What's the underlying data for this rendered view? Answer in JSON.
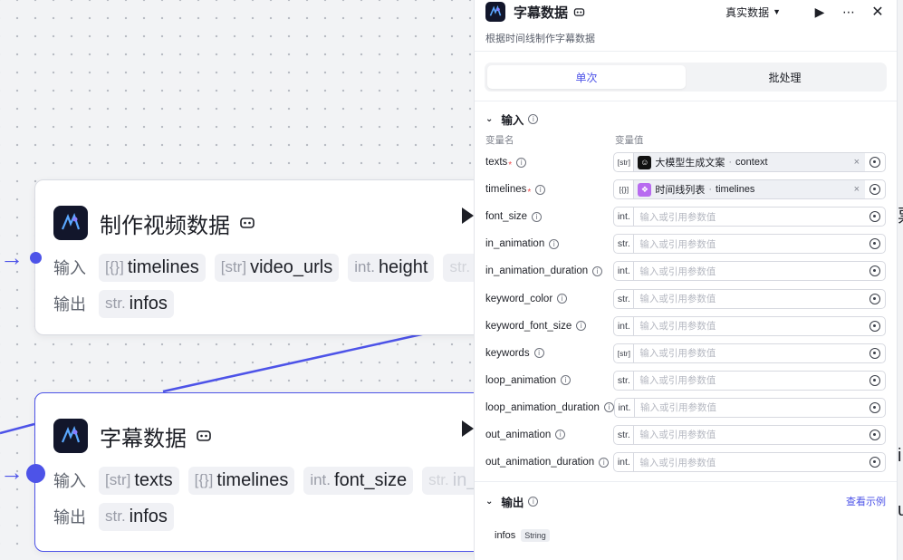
{
  "canvas": {
    "nodes": [
      {
        "title": "制作视频数据",
        "input_label": "输入",
        "output_label": "输出",
        "inputs": [
          {
            "type": "[{}]",
            "name": "timelines"
          },
          {
            "type": "[str]",
            "name": "video_urls"
          },
          {
            "type": "int.",
            "name": "height"
          },
          {
            "type": "str.",
            "name": ""
          }
        ],
        "outputs": [
          {
            "type": "str.",
            "name": "infos"
          }
        ]
      },
      {
        "title": "字幕数据",
        "input_label": "输入",
        "output_label": "输出",
        "inputs": [
          {
            "type": "[str]",
            "name": "texts"
          },
          {
            "type": "[{}]",
            "name": "timelines"
          },
          {
            "type": "int.",
            "name": "font_size"
          },
          {
            "type": "str.",
            "name": "in_"
          }
        ],
        "outputs": [
          {
            "type": "str.",
            "name": "infos"
          }
        ]
      }
    ],
    "colors": {
      "accent": "#4d53e8",
      "canvas_bg": "#f2f3f5"
    }
  },
  "panel": {
    "title": "字幕数据",
    "mode": "真实数据",
    "description": "根据时间线制作字幕数据",
    "tabs": [
      {
        "label": "单次",
        "active": true
      },
      {
        "label": "批处理",
        "active": false
      }
    ],
    "input_section": "输入",
    "col_name": "变量名",
    "col_value": "变量值",
    "params": [
      {
        "name": "texts",
        "required": true,
        "type": "[str]",
        "ref": {
          "source": "大模型生成文案",
          "field": "context",
          "icon_color": "#111111"
        }
      },
      {
        "name": "timelines",
        "required": true,
        "type": "[{}]",
        "ref": {
          "source": "时间线列表",
          "field": "timelines",
          "icon_color": "#b86bf0"
        }
      },
      {
        "name": "font_size",
        "required": false,
        "type": "int.",
        "placeholder": "输入或引用参数值"
      },
      {
        "name": "in_animation",
        "required": false,
        "type": "str.",
        "placeholder": "输入或引用参数值"
      },
      {
        "name": "in_animation_duration",
        "required": false,
        "type": "int.",
        "placeholder": "输入或引用参数值"
      },
      {
        "name": "keyword_color",
        "required": false,
        "type": "str.",
        "placeholder": "输入或引用参数值"
      },
      {
        "name": "keyword_font_size",
        "required": false,
        "type": "int.",
        "placeholder": "输入或引用参数值"
      },
      {
        "name": "keywords",
        "required": false,
        "type": "[str]",
        "placeholder": "输入或引用参数值"
      },
      {
        "name": "loop_animation",
        "required": false,
        "type": "str.",
        "placeholder": "输入或引用参数值"
      },
      {
        "name": "loop_animation_duration",
        "required": false,
        "type": "int.",
        "placeholder": "输入或引用参数值"
      },
      {
        "name": "out_animation",
        "required": false,
        "type": "str.",
        "placeholder": "输入或引用参数值"
      },
      {
        "name": "out_animation_duration",
        "required": false,
        "type": "int.",
        "placeholder": "输入或引用参数值"
      }
    ],
    "output_section": "输出",
    "output_example": "查看示例",
    "outputs": [
      {
        "name": "infos",
        "type": "String"
      }
    ]
  },
  "peek": {
    "glyph_1": "票",
    "glyph_2": "i",
    "glyph_3": "u"
  }
}
